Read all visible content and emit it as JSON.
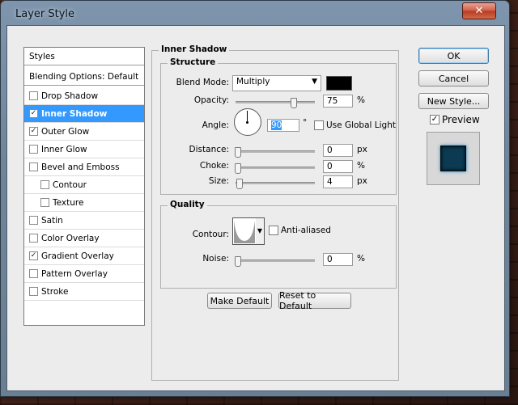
{
  "window": {
    "title": "Layer Style",
    "close_label": "✕"
  },
  "styles_list": {
    "header": "Styles",
    "blending": "Blending Options: Default",
    "items": [
      {
        "label": "Drop Shadow",
        "checked": false,
        "selected": false,
        "indent": false
      },
      {
        "label": "Inner Shadow",
        "checked": true,
        "selected": true,
        "indent": false
      },
      {
        "label": "Outer Glow",
        "checked": true,
        "selected": false,
        "indent": false
      },
      {
        "label": "Inner Glow",
        "checked": false,
        "selected": false,
        "indent": false
      },
      {
        "label": "Bevel and Emboss",
        "checked": false,
        "selected": false,
        "indent": false
      },
      {
        "label": "Contour",
        "checked": false,
        "selected": false,
        "indent": true
      },
      {
        "label": "Texture",
        "checked": false,
        "selected": false,
        "indent": true
      },
      {
        "label": "Satin",
        "checked": false,
        "selected": false,
        "indent": false
      },
      {
        "label": "Color Overlay",
        "checked": false,
        "selected": false,
        "indent": false
      },
      {
        "label": "Gradient Overlay",
        "checked": true,
        "selected": false,
        "indent": false
      },
      {
        "label": "Pattern Overlay",
        "checked": false,
        "selected": false,
        "indent": false
      },
      {
        "label": "Stroke",
        "checked": false,
        "selected": false,
        "indent": false
      }
    ]
  },
  "panel": {
    "title": "Inner Shadow",
    "structure": {
      "title": "Structure",
      "blend_mode_label": "Blend Mode:",
      "blend_mode_value": "Multiply",
      "blend_color": "#000000",
      "opacity_label": "Opacity:",
      "opacity_value": "75",
      "opacity_unit": "%",
      "opacity_fraction": 0.75,
      "angle_label": "Angle:",
      "angle_value": "90",
      "angle_unit": "°",
      "global_light_label": "Use Global Light",
      "global_light_checked": false,
      "distance_label": "Distance:",
      "distance_value": "0",
      "distance_unit": "px",
      "choke_label": "Choke:",
      "choke_value": "0",
      "choke_unit": "%",
      "size_label": "Size:",
      "size_value": "4",
      "size_unit": "px"
    },
    "quality": {
      "title": "Quality",
      "contour_label": "Contour:",
      "anti_aliased_label": "Anti-aliased",
      "anti_aliased_checked": false,
      "noise_label": "Noise:",
      "noise_value": "0",
      "noise_unit": "%"
    },
    "make_default_label": "Make Default",
    "reset_default_label": "Reset to Default"
  },
  "actions": {
    "ok_label": "OK",
    "cancel_label": "Cancel",
    "new_style_label": "New Style...",
    "preview_label": "Preview",
    "preview_checked": true,
    "preview_color": "#0b3a52"
  }
}
